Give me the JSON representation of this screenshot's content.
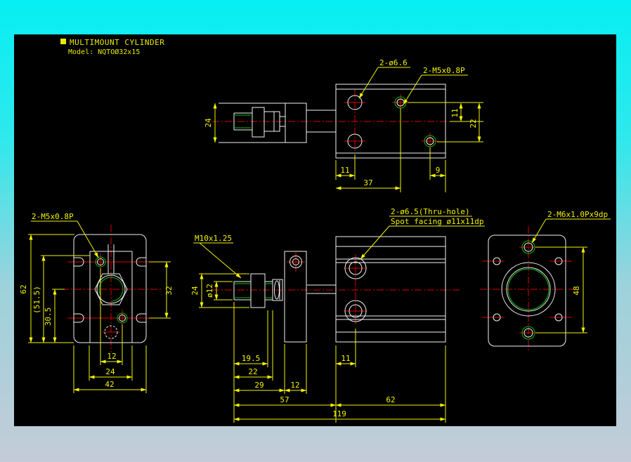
{
  "app": {
    "canvas_color": "#000000",
    "frame_top_color": "#06eff3",
    "frame_bottom_color": "#c3ccd8"
  },
  "colors": {
    "geometry": "#f2f2f2",
    "dimensions": "#f2f200",
    "centerlines": "#dd0000",
    "threads": "#00c000"
  },
  "title_block": {
    "title": "MULTIMOUNT CYLINDER",
    "model": "Model: NQTOØ32x15"
  },
  "views": {
    "top": {
      "labels": {
        "holes": "2-ø6.6",
        "threads": "2-M5x0.8P"
      },
      "dims": {
        "rod_height": "24",
        "offset_v": "11",
        "spacing_v": "22",
        "offset_h": "11",
        "thread_edge": "9",
        "thread_pos": "37"
      }
    },
    "front": {
      "labels": {
        "threads": "2-M5x0.8P"
      },
      "dims": {
        "height": "62",
        "ref_height": "(51.5)",
        "center_to_bottom": "30.5",
        "notch_spacing": "32",
        "thread_spacing": "12",
        "tube": "24",
        "width": "42"
      }
    },
    "side": {
      "labels": {
        "rod_thread": "M10x1.25",
        "thru_hole_line1": "2-ø6.5(Thru-hole)",
        "thru_hole_line2": "Spot facing ø11x11dp"
      },
      "dims": {
        "nut_width": "24",
        "rod_dia": "ø12",
        "thread_len": "19.5",
        "rod_ext": "22",
        "to_plate": "29",
        "plate_thk": "12",
        "hole_offset": "11",
        "front_len": "57",
        "body_len": "62",
        "total_len": "119"
      }
    },
    "end": {
      "labels": {
        "threads": "2-M6x1.0Px9dp"
      },
      "dims": {
        "hole_spacing": "48"
      }
    }
  }
}
